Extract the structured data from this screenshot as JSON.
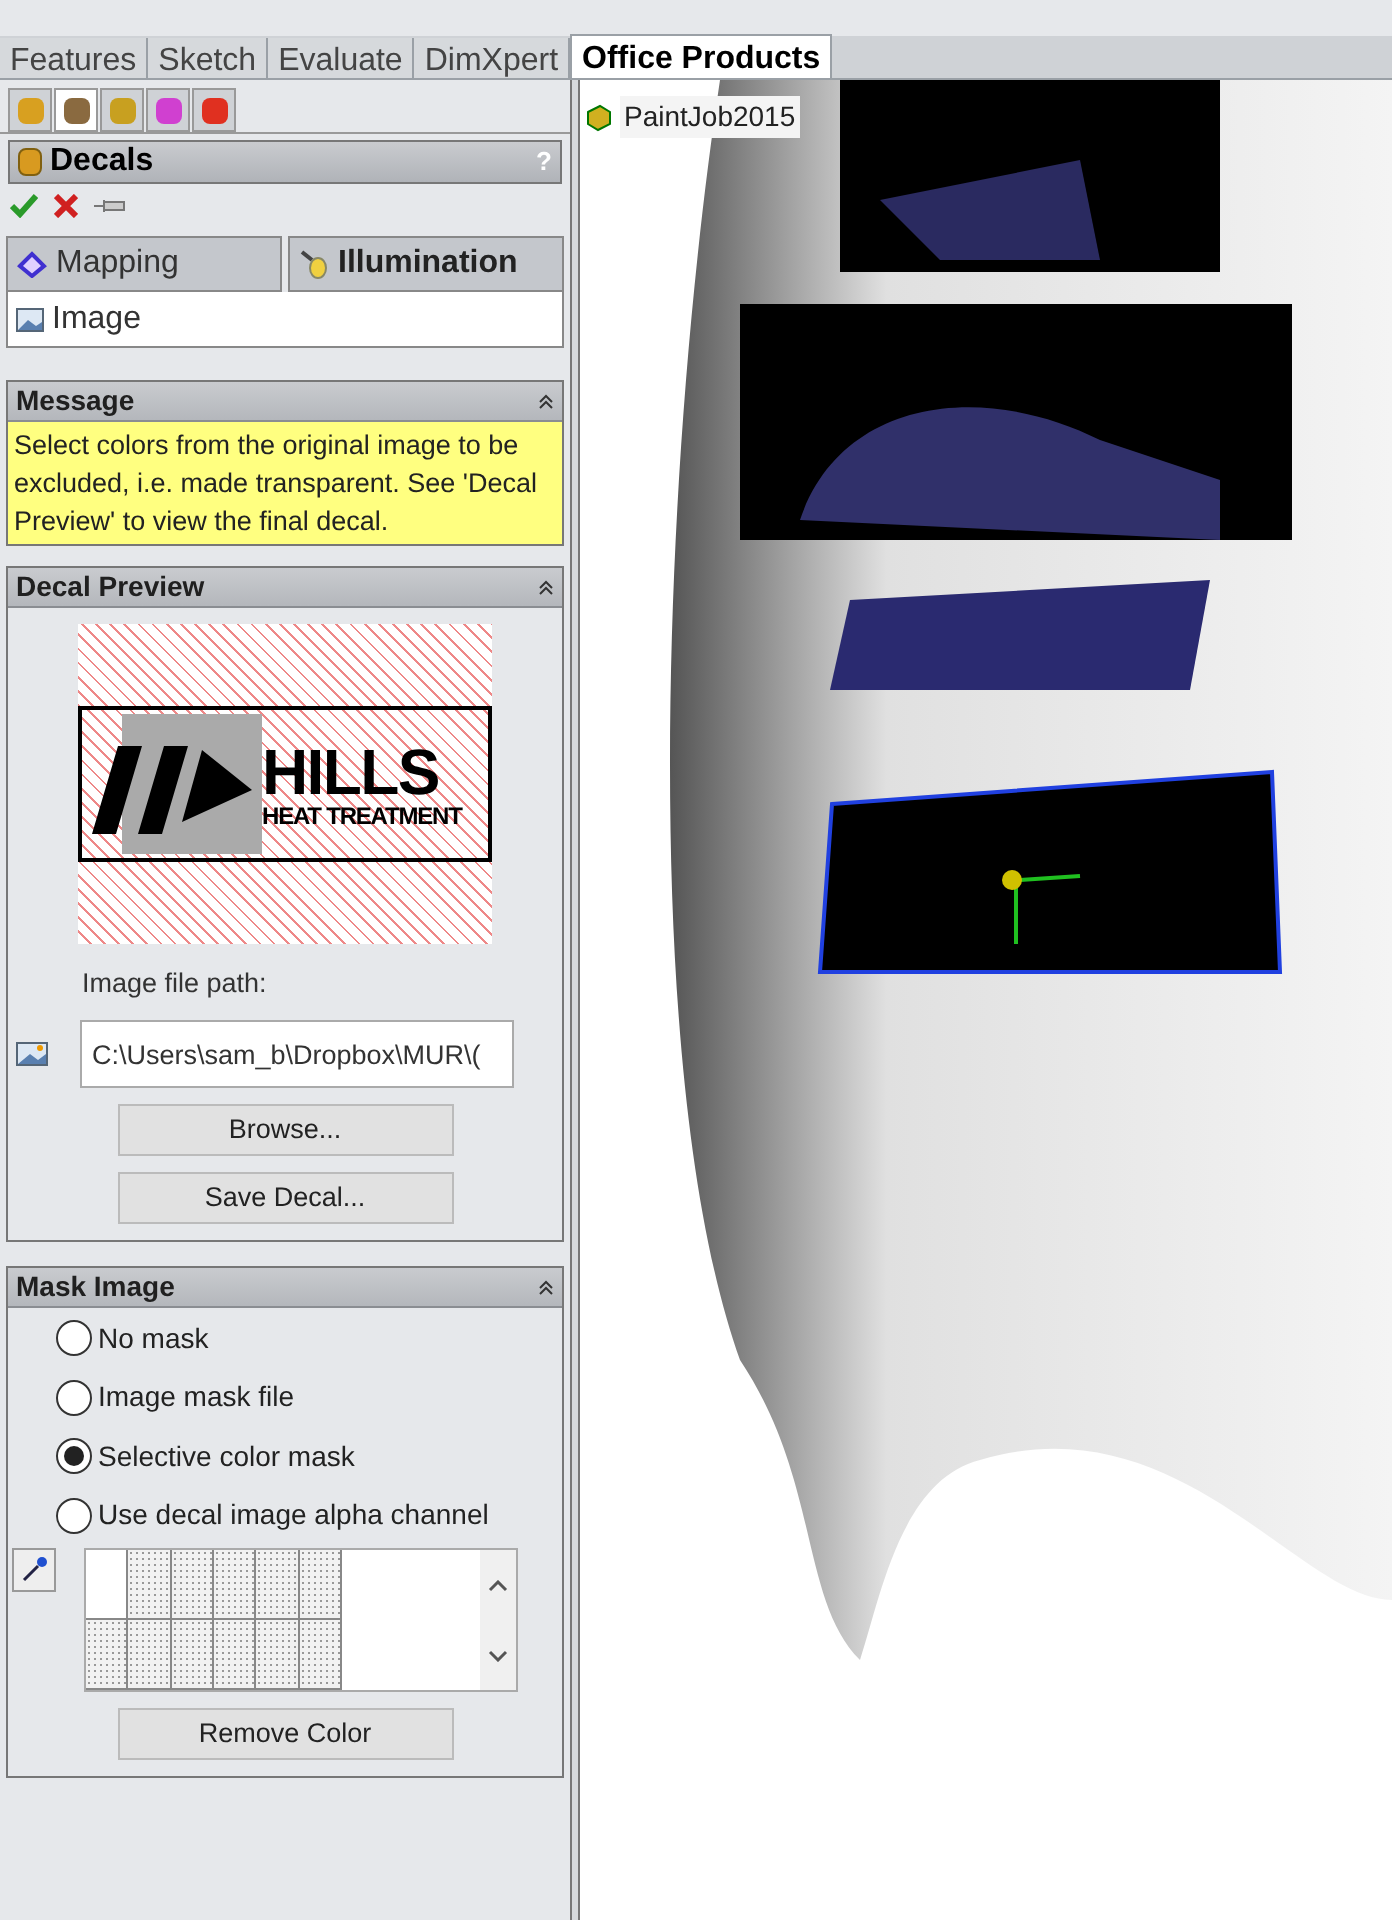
{
  "command_tabs": [
    {
      "label": "Features",
      "selected": false
    },
    {
      "label": "Sketch",
      "selected": false
    },
    {
      "label": "Evaluate",
      "selected": false
    },
    {
      "label": "DimXpert",
      "selected": false
    },
    {
      "label": "Office Products",
      "selected": true
    }
  ],
  "manager_tabs": [
    {
      "kind": "feature",
      "selected": false
    },
    {
      "kind": "property",
      "selected": true
    },
    {
      "kind": "config",
      "selected": false
    },
    {
      "kind": "dimxpert",
      "selected": false
    },
    {
      "kind": "display",
      "selected": false
    }
  ],
  "panel": {
    "title": "Decals",
    "help": "?"
  },
  "sub_tabs": [
    {
      "label": "Mapping",
      "kind": "mapping",
      "selected": false
    },
    {
      "label": "Illumination",
      "kind": "illumination",
      "selected": false
    }
  ],
  "image_tab": {
    "label": "Image"
  },
  "message": {
    "title": "Message",
    "text": "Select colors from the original image to be excluded, i.e. made transparent. See 'Decal Preview' to view the final decal.",
    "expanded": true
  },
  "decal_preview": {
    "title": "Decal Preview",
    "expanded": true,
    "logo_lines": [
      "HILLS",
      "HEAT TREATMENT"
    ],
    "path_label": "Image file path:",
    "path_value": "C:\\Users\\sam_b\\Dropbox\\MUR\\(",
    "buttons": [
      "Browse...",
      "Save Decal..."
    ]
  },
  "mask_image": {
    "title": "Mask Image",
    "expanded": true,
    "options": [
      {
        "label": "No mask",
        "selected": false
      },
      {
        "label": "Image mask file",
        "selected": false
      },
      {
        "label": "Selective color mask",
        "selected": true
      },
      {
        "label": "Use decal image alpha channel",
        "selected": false
      }
    ],
    "button": "Remove Color"
  },
  "tree": {
    "item": "PaintJob2015"
  }
}
